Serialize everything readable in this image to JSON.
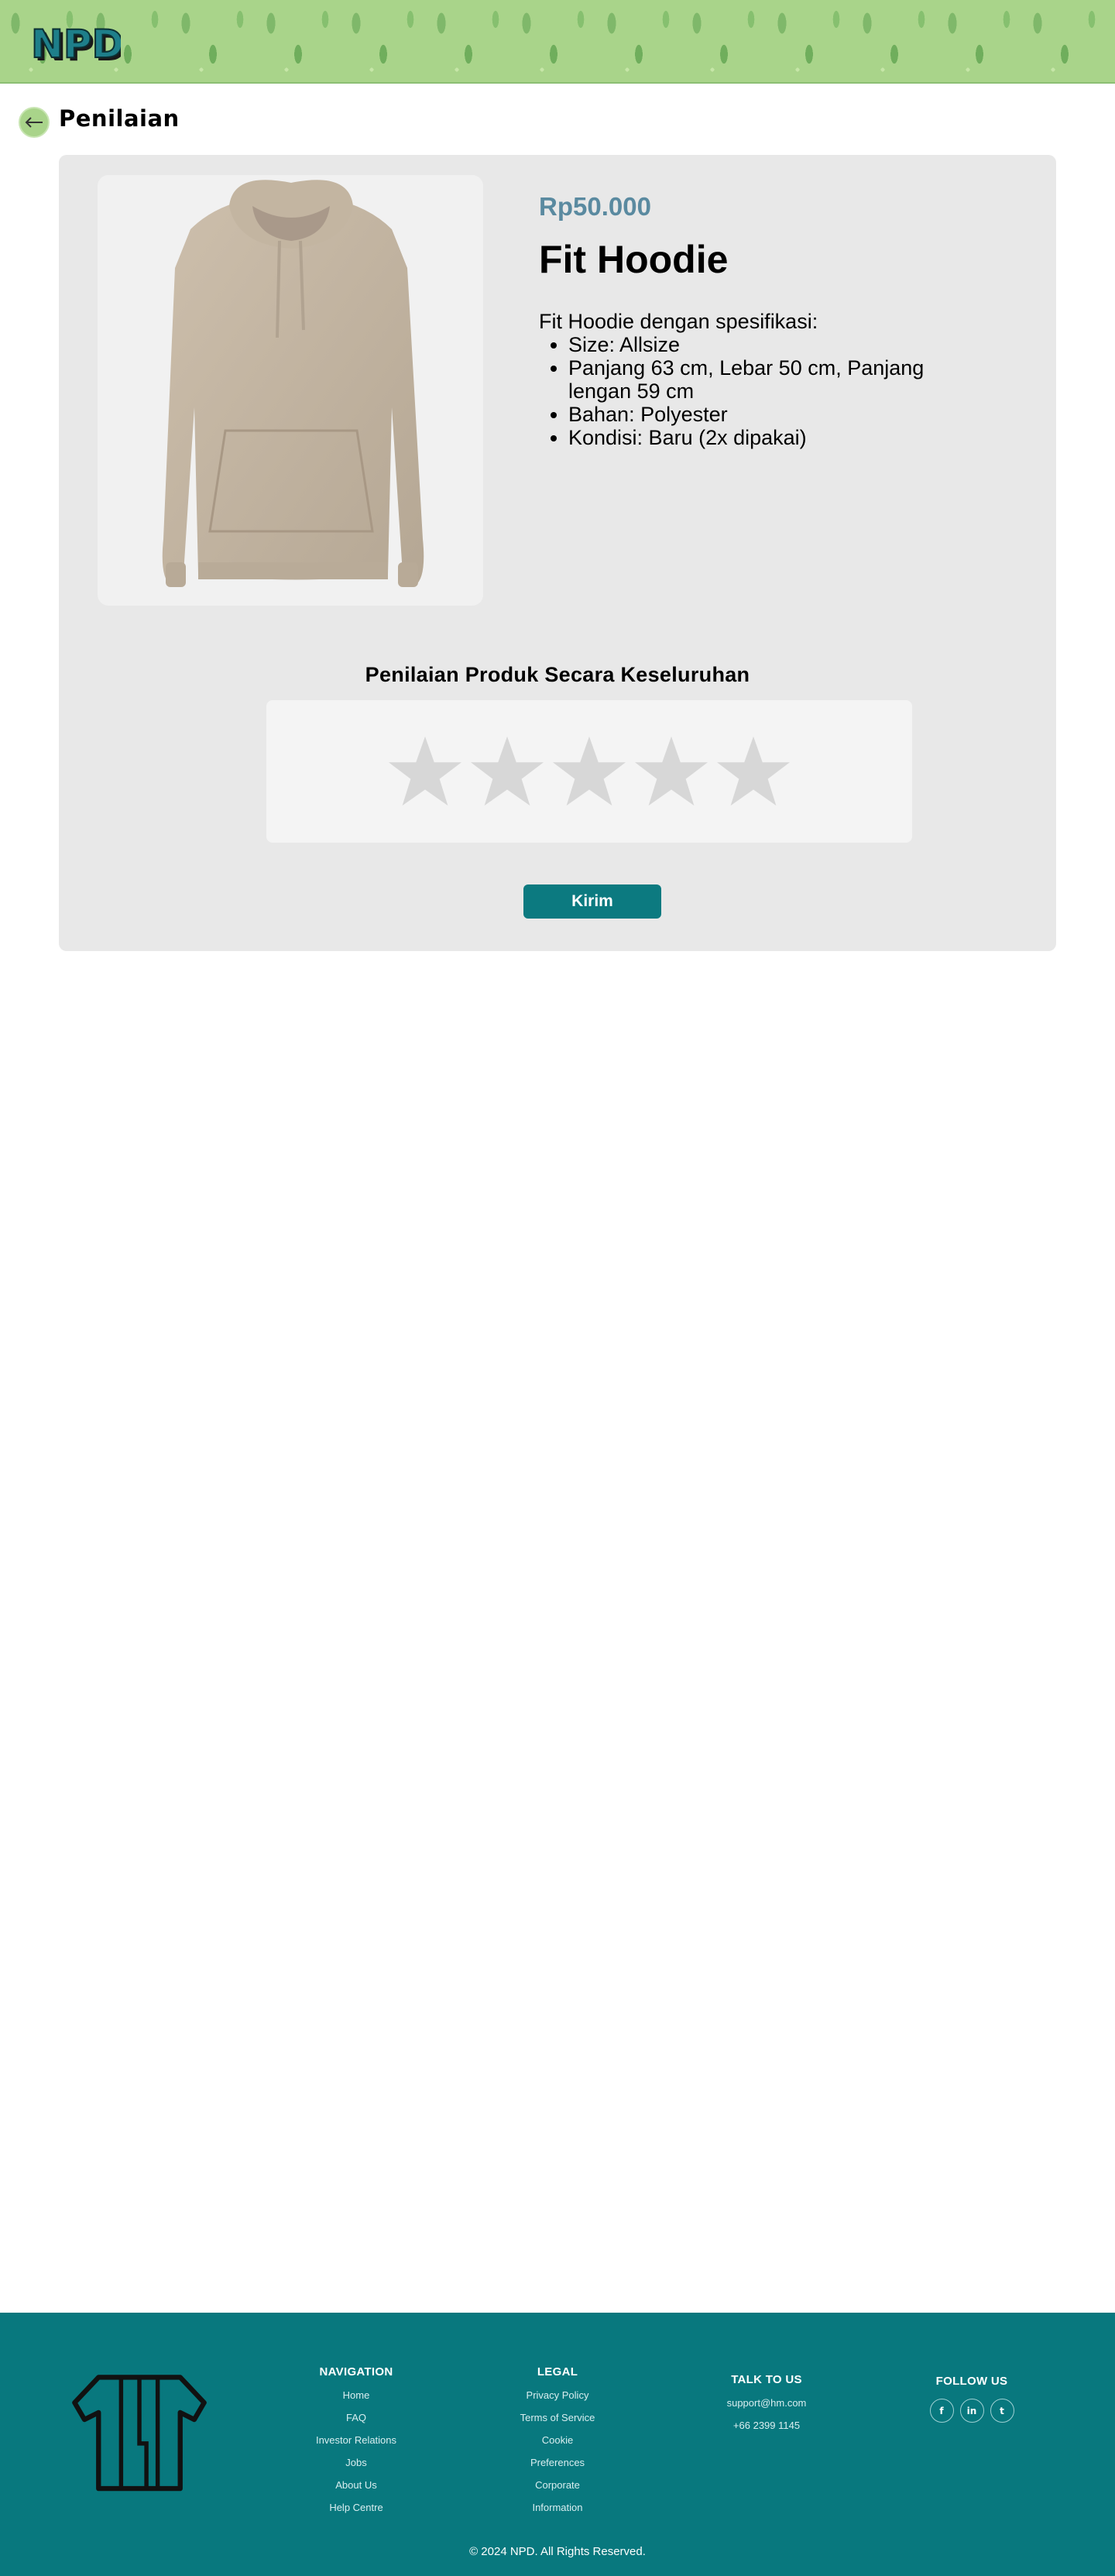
{
  "header": {
    "logo_text": "NPD",
    "page_title": "Penilaian",
    "back_icon": "arrow-left-icon"
  },
  "product": {
    "price": "Rp50.000",
    "name": "Fit Hoodie",
    "description_intro": "Fit Hoodie dengan spesifikasi:",
    "specs": [
      "Size: Allsize",
      "Panjang 63 cm, Lebar 50 cm, Panjang lengan 59 cm",
      "Bahan: Polyester",
      "Kondisi: Baru (2x dipakai)"
    ],
    "image": "hoodie-image"
  },
  "rating": {
    "title": "Penilaian Produk Secara Keseluruhan",
    "max_stars": 5,
    "selected": 0,
    "star_color": "#d7d7d7"
  },
  "submit_label": "Kirim",
  "footer": {
    "navigation": {
      "title": "NAVIGATION",
      "links": [
        "Home",
        "FAQ",
        "Investor Relations",
        "Jobs",
        "About Us",
        "Help Centre"
      ]
    },
    "legal": {
      "title": "LEGAL",
      "links": [
        "Privacy Policy",
        "Terms of Service",
        "Cookie",
        "Preferences",
        "Corporate",
        "Information"
      ]
    },
    "talk": {
      "title": "TALK TO US",
      "email": "support@hm.com",
      "phone": "+66 2399 1145"
    },
    "follow": {
      "title": "FOLLOW US",
      "socials": [
        {
          "icon": "facebook-icon",
          "glyph": "f"
        },
        {
          "icon": "linkedin-icon",
          "glyph": "in"
        },
        {
          "icon": "twitter-icon",
          "glyph": "t"
        }
      ]
    },
    "copyright": "© 2024 NPD. All Rights Reserved."
  },
  "colors": {
    "accent": "#08787e",
    "price": "#5a8aa0",
    "banner": "#a9d48a",
    "card": "#e8e8e8"
  }
}
